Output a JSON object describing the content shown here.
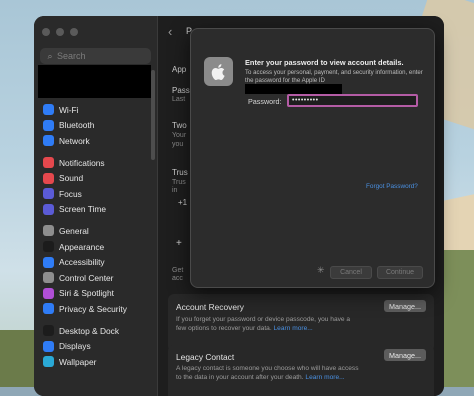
{
  "search": {
    "placeholder": "Search"
  },
  "sidebar": {
    "groups": [
      [
        {
          "label": "Wi-Fi",
          "icon": "wifi-icon",
          "color": "#2f7cf6"
        },
        {
          "label": "Bluetooth",
          "icon": "bluetooth-icon",
          "color": "#2f7cf6"
        },
        {
          "label": "Network",
          "icon": "network-icon",
          "color": "#2f7cf6"
        }
      ],
      [
        {
          "label": "Notifications",
          "icon": "bell-icon",
          "color": "#e5484d"
        },
        {
          "label": "Sound",
          "icon": "speaker-icon",
          "color": "#e5484d"
        },
        {
          "label": "Focus",
          "icon": "moon-icon",
          "color": "#5b5bd6"
        },
        {
          "label": "Screen Time",
          "icon": "hourglass-icon",
          "color": "#5b5bd6"
        }
      ],
      [
        {
          "label": "General",
          "icon": "gear-icon",
          "color": "#8e8e8e"
        },
        {
          "label": "Appearance",
          "icon": "appearance-icon",
          "color": "#1c1c1c"
        },
        {
          "label": "Accessibility",
          "icon": "accessibility-icon",
          "color": "#2f7cf6"
        },
        {
          "label": "Control Center",
          "icon": "control-center-icon",
          "color": "#8e8e8e"
        },
        {
          "label": "Siri & Spotlight",
          "icon": "siri-icon",
          "color": "#b04fd6"
        },
        {
          "label": "Privacy & Security",
          "icon": "hand-icon",
          "color": "#2f7cf6"
        }
      ],
      [
        {
          "label": "Desktop & Dock",
          "icon": "dock-icon",
          "color": "#1c1c1c"
        },
        {
          "label": "Displays",
          "icon": "display-icon",
          "color": "#2f7cf6"
        },
        {
          "label": "Wallpaper",
          "icon": "wallpaper-icon",
          "color": "#2aa9d6"
        }
      ]
    ]
  },
  "content": {
    "title_frag": "P",
    "frag_app": "App",
    "frag_pass": "Pass",
    "frag_last": "Last",
    "frag_two": "Two",
    "frag_your1": "Your",
    "frag_you": "you",
    "frag_trus": "Trus",
    "frag_trus_sub1": "Trus",
    "frag_trus_sub2": "in",
    "frag_plus1": "+1",
    "frag_plus": "+",
    "frag_get1": "Get",
    "frag_get2": "acc",
    "account_recovery": {
      "title": "Account Recovery",
      "body": "If you forget your password or device passcode, you have a few options to recover your data.",
      "link": "Learn more...",
      "button": "Manage..."
    },
    "legacy_contact": {
      "title": "Legacy Contact",
      "body": "A legacy contact is someone you choose who will have access to the data in your account after your death.",
      "link": "Learn more...",
      "button": "Manage..."
    }
  },
  "dialog": {
    "title": "Enter your password to view account details.",
    "message": "To access your personal, payment, and security information, enter the password for the Apple ID",
    "password_label": "Password:",
    "password_value": "•••••••••",
    "forgot": "Forgot Password?",
    "cancel": "Cancel",
    "continue": "Continue"
  }
}
